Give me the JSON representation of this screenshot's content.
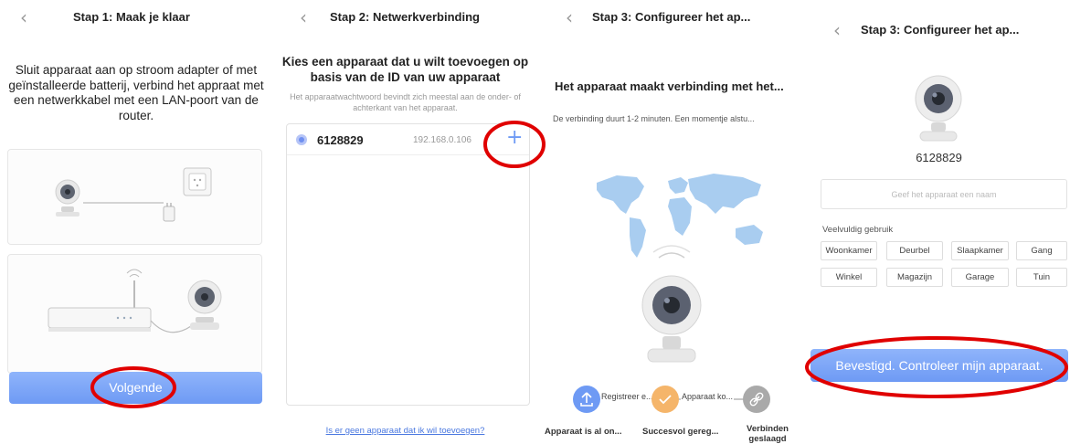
{
  "colors": {
    "accent": "#6e9af4",
    "annotation": "#e00000",
    "orange": "#f5b56a",
    "gray_step": "#a9a9a9",
    "map_blue": "#a9cdf0"
  },
  "panel1": {
    "title": "Stap 1: Maak je klaar",
    "instructions": "Sluit apparaat aan op stroom adapter of met geïnstalleerde batterij, verbind het appraat met een netwerkkabel met een LAN-poort van de router.",
    "next_button": "Volgende",
    "icons": [
      "back-icon",
      "camera-icon",
      "power-adapter-icon",
      "wall-socket-icon",
      "router-icon",
      "camera-icon"
    ]
  },
  "panel2": {
    "title": "Stap 2: Netwerkverbinding",
    "heading": "Kies een apparaat dat u wilt toevoegen op basis van de ID van uw apparaat",
    "subtext": "Het apparaatwachtwoord bevindt zich meestal aan de onder- of achterkant van het apparaat.",
    "device": {
      "id": "6128829",
      "ip": "192.168.0.106"
    },
    "add_symbol": "+",
    "no_device_link": "Is er geen apparaat dat ik wil toevoegen?"
  },
  "panel3": {
    "title": "Stap 3: Configureer het ap...",
    "heading": "Het apparaat maakt verbinding met het...",
    "subtext": "De verbinding duurt 1-2 minuten. Een momentje alstu...",
    "steps": [
      {
        "label": "Registreer e...",
        "status": "Apparaat is al on..."
      },
      {
        "label": "Apparaat ko...",
        "status": "Succesvol gereg..."
      },
      {
        "label": "",
        "status": "Verbinden geslaagd"
      }
    ]
  },
  "panel4": {
    "title": "Stap 3: Configureer het ap...",
    "device_id": "6128829",
    "name_placeholder": "Geef het apparaat een naam",
    "section_label": "Veelvuldig gebruik",
    "chips": [
      "Woonkamer",
      "Deurbel",
      "Slaapkamer",
      "Gang",
      "Winkel",
      "Magazijn",
      "Garage",
      "Tuin"
    ],
    "confirm_button": "Bevestigd. Controleer mijn apparaat."
  }
}
